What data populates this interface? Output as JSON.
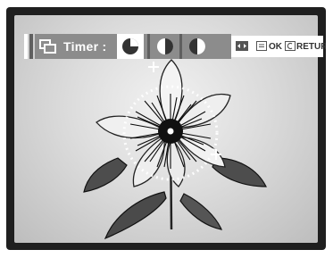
{
  "osd": {
    "timer_label": "Timer :",
    "ok_label": "OK",
    "return_label": "RETURN"
  }
}
